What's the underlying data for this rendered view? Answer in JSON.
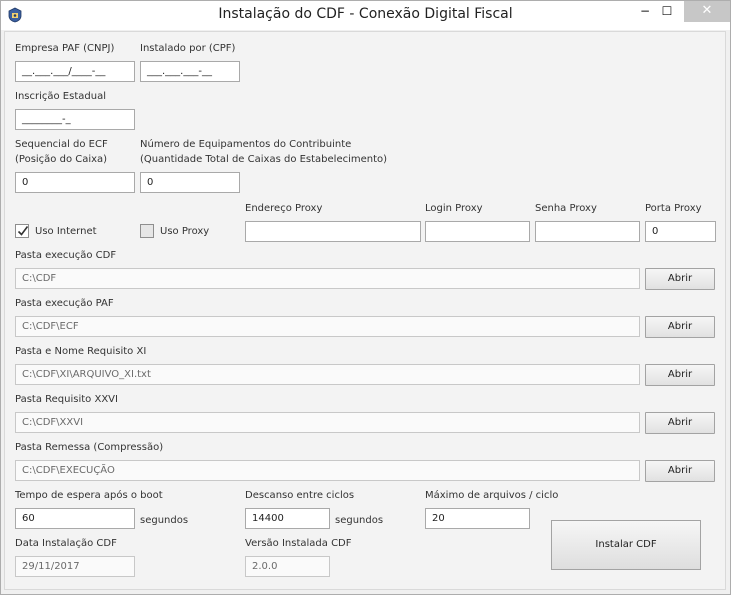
{
  "window": {
    "title": "Instalação do CDF - Conexão Digital Fiscal",
    "min_glyph": "−",
    "max_glyph": "☐",
    "close_glyph": "✕"
  },
  "form": {
    "empresa_paf_label": "Empresa PAF (CNPJ)",
    "empresa_paf_value": "__.___.___/____-__",
    "instalado_por_label": "Instalado por (CPF)",
    "instalado_por_value": "___.___.___-__",
    "inscricao_label": "Inscrição Estadual",
    "inscricao_value": "________-_",
    "sequencial_label_1": "Sequencial do ECF",
    "sequencial_label_2": "(Posição do Caixa)",
    "sequencial_value": "0",
    "num_equip_label_1": "Número de Equipamentos do Contribuinte",
    "num_equip_label_2": "(Quantidade Total de Caixas do Estabelecimento)",
    "num_equip_value": "0",
    "uso_internet_label": "Uso Internet",
    "uso_internet_checked": true,
    "uso_proxy_label": "Uso Proxy",
    "uso_proxy_checked": false,
    "endereco_proxy_label": "Endereço Proxy",
    "endereco_proxy_value": "",
    "login_proxy_label": "Login Proxy",
    "login_proxy_value": "",
    "senha_proxy_label": "Senha Proxy",
    "senha_proxy_value": "",
    "porta_proxy_label": "Porta Proxy",
    "porta_proxy_value": "0",
    "paths": [
      {
        "label": "Pasta execução CDF",
        "value": "C:\\CDF",
        "button": "Abrir"
      },
      {
        "label": "Pasta execução PAF",
        "value": "C:\\CDF\\ECF",
        "button": "Abrir"
      },
      {
        "label": "Pasta e Nome Requisito XI",
        "value": "C:\\CDF\\XI\\ARQUIVO_XI.txt",
        "button": "Abrir"
      },
      {
        "label": "Pasta Requisito XXVI",
        "value": "C:\\CDF\\XXVI",
        "button": "Abrir"
      },
      {
        "label": "Pasta Remessa (Compressão)",
        "value": "C:\\CDF\\EXECUÇÃO",
        "button": "Abrir"
      }
    ],
    "tempo_espera_label": "Tempo de espera após o boot",
    "tempo_espera_value": "60",
    "tempo_espera_unit": "segundos",
    "descanso_label": "Descanso entre ciclos",
    "descanso_value": "14400",
    "descanso_unit": "segundos",
    "max_arquivos_label": "Máximo de arquivos / ciclo",
    "max_arquivos_value": "20",
    "data_instalacao_label": "Data Instalação CDF",
    "data_instalacao_value": "29/11/2017",
    "versao_label": "Versão Instalada CDF",
    "versao_value": "2.0.0",
    "instalar_button": "Instalar CDF"
  }
}
